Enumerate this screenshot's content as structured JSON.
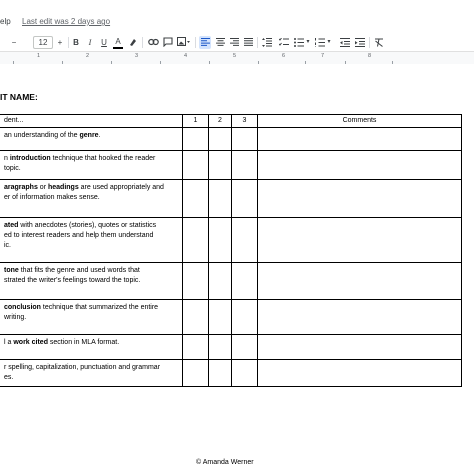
{
  "menu": {
    "help": "elp",
    "last_edit": "Last edit was 2 days ago"
  },
  "toolbar": {
    "font_size": "12",
    "decrease": "−",
    "increase": "+",
    "bold": "B",
    "italic": "I",
    "underline": "U",
    "text_color": "A",
    "dash": "–"
  },
  "ruler": {
    "ticks": [
      "1",
      "2",
      "3",
      "4",
      "5",
      "6",
      "7",
      "8"
    ]
  },
  "doc": {
    "title": "IT NAME:",
    "footer": "© Amanda Werner",
    "headers": {
      "criteria": "dent...",
      "s1": "1",
      "s2": "2",
      "s3": "3",
      "comments": "Comments"
    },
    "rows": [
      {
        "parts": [
          {
            "t": "an understanding of the ",
            "b": false
          },
          {
            "t": "genre",
            "b": true
          },
          {
            "t": ".",
            "b": false
          }
        ]
      },
      {
        "parts": [
          {
            "t": "n ",
            "b": false
          },
          {
            "t": "introduction",
            "b": true
          },
          {
            "t": " technique that hooked the reader",
            "b": false
          },
          {
            "br": true
          },
          {
            "t": "topic.",
            "b": false
          }
        ]
      },
      {
        "parts": [
          {
            "t": "aragraphs",
            "b": true
          },
          {
            "t": " or ",
            "b": false
          },
          {
            "t": "headings",
            "b": true
          },
          {
            "t": " are used appropriately and",
            "b": false
          },
          {
            "br": true
          },
          {
            "t": "er of information makes sense.",
            "b": false
          }
        ]
      },
      {
        "parts": [
          {
            "t": "ated",
            "b": true
          },
          {
            "t": " with anecdotes (stories), quotes or statistics",
            "b": false
          },
          {
            "br": true
          },
          {
            "t": "ed to interest readers and help them understand",
            "b": false
          },
          {
            "br": true
          },
          {
            "t": "ic.",
            "b": false
          }
        ]
      },
      {
        "parts": [
          {
            "t": "tone",
            "b": true
          },
          {
            "t": " that fits the genre and used words that",
            "b": false
          },
          {
            "br": true
          },
          {
            "t": "strated the writer's feelings toward the topic.",
            "b": false
          }
        ]
      },
      {
        "parts": [
          {
            "t": "conclusion",
            "b": true
          },
          {
            "t": " technique that summarized the entire",
            "b": false
          },
          {
            "br": true
          },
          {
            "t": "  writing.",
            "b": false
          }
        ]
      },
      {
        "parts": [
          {
            "t": "l a ",
            "b": false
          },
          {
            "t": "work cited",
            "b": true
          },
          {
            "t": " section in MLA format.",
            "b": false
          }
        ]
      },
      {
        "parts": [
          {
            "t": "r spelling, capitalization, punctuation and grammar",
            "b": false
          },
          {
            "br": true
          },
          {
            "t": "es.",
            "b": false
          }
        ]
      }
    ]
  }
}
